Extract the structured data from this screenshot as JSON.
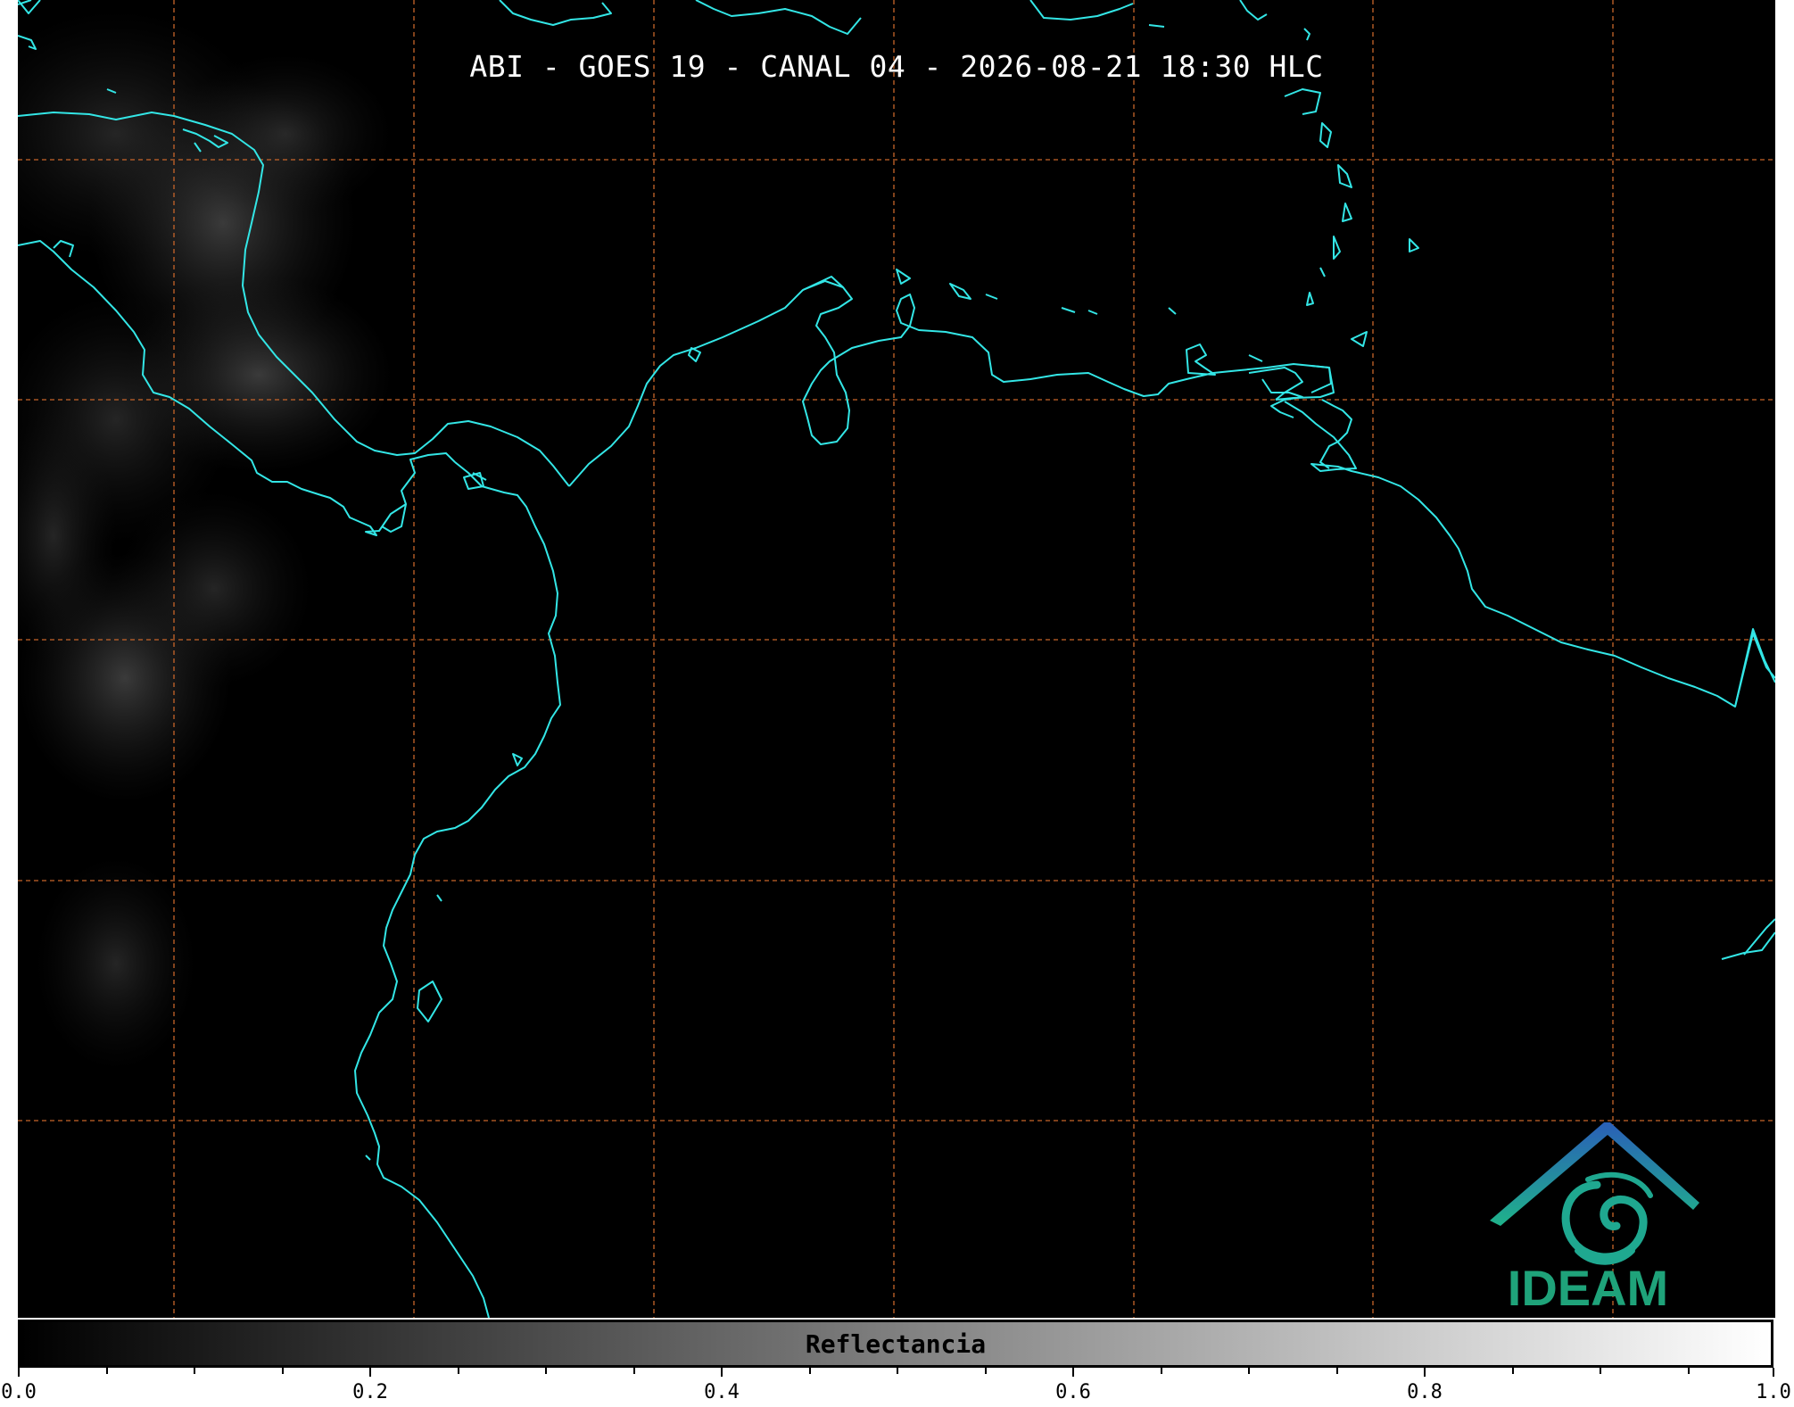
{
  "map": {
    "title": "ABI - GOES 19 - CANAL 04 - 2026-08-21 18:30 HLC",
    "coastline_color": "#33e6e6",
    "graticule_color": "#c8652a",
    "background_color": "#000000"
  },
  "colorbar": {
    "label": "Reflectancia",
    "range": [
      0.0,
      1.0
    ],
    "colormap": "grayscale black to white",
    "ticks": [
      "0.0",
      "0.2",
      "0.4",
      "0.6",
      "0.8",
      "1.0"
    ]
  },
  "logo": {
    "text": "IDEAM",
    "color": "#1fa37a"
  }
}
